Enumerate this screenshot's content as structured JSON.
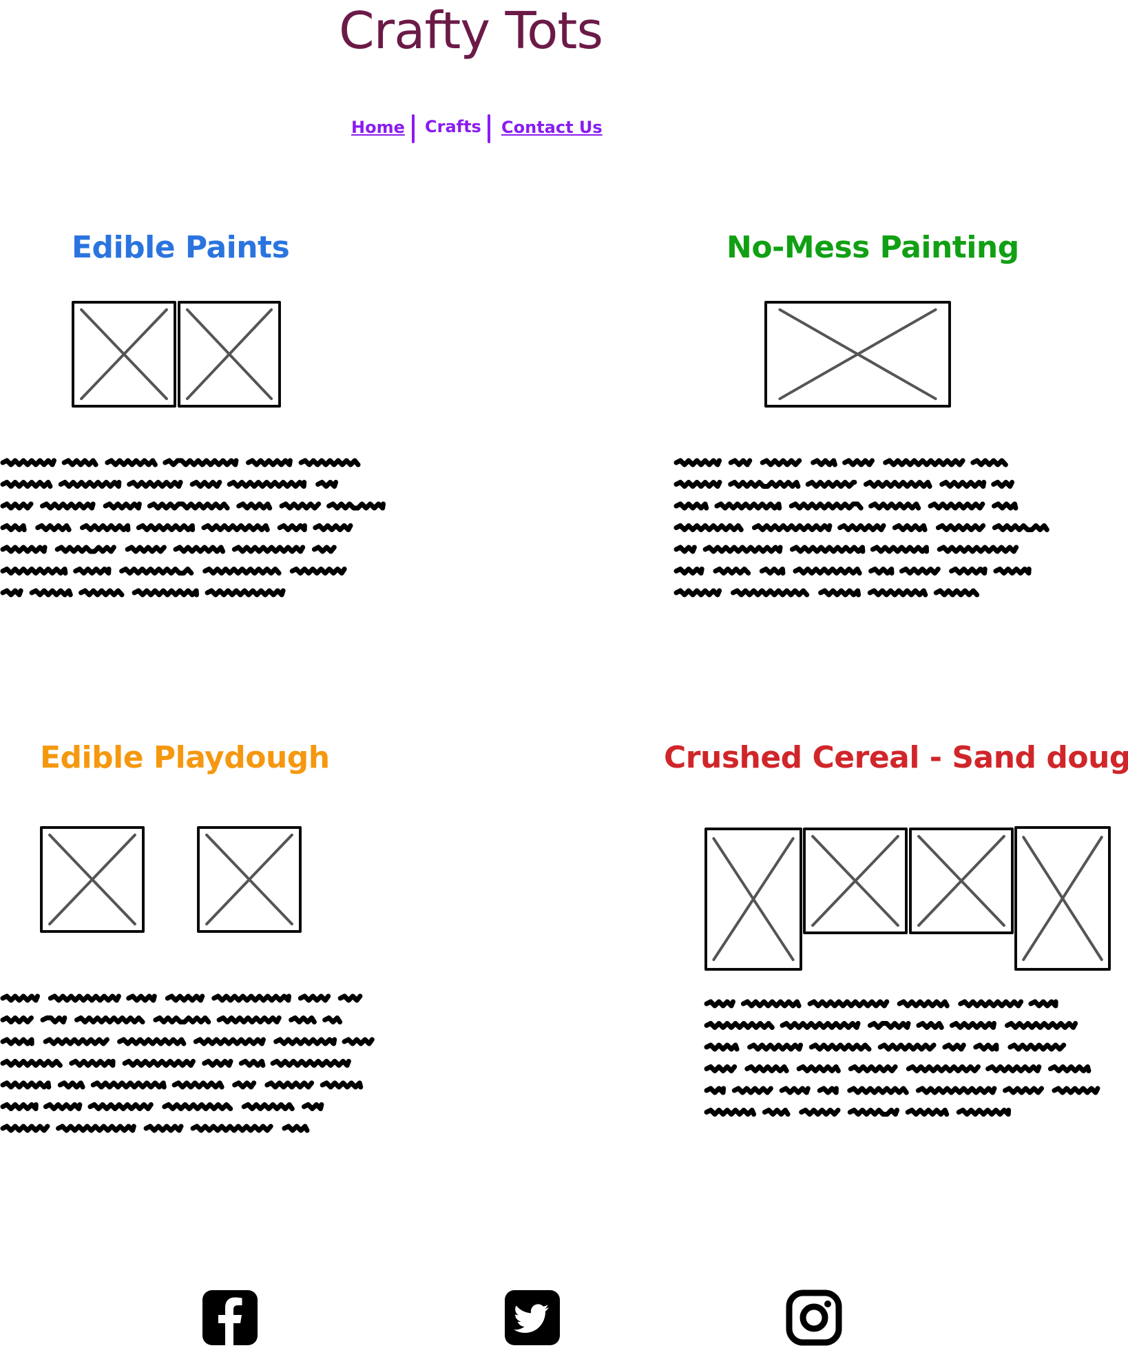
{
  "site": {
    "title": "Crafty Tots"
  },
  "nav": {
    "items": [
      {
        "label": "Home"
      },
      {
        "label": "Crafts"
      },
      {
        "label": "Contact Us"
      }
    ]
  },
  "sections": [
    {
      "heading": "Edible Paints",
      "color": "#2b74df",
      "image_count": 2
    },
    {
      "heading": "No-Mess Painting",
      "color": "#11a014",
      "image_count": 1
    },
    {
      "heading": "Edible Playdough",
      "color": "#f5980f",
      "image_count": 2
    },
    {
      "heading": "Crushed Cereal - Sand dough",
      "color": "#d0262a",
      "image_count": 4
    }
  ],
  "footer": {
    "social_icons": [
      "facebook-icon",
      "twitter-icon",
      "instagram-icon"
    ]
  },
  "colors": {
    "title": "#6b1a47",
    "nav": "#8a1cf0"
  }
}
